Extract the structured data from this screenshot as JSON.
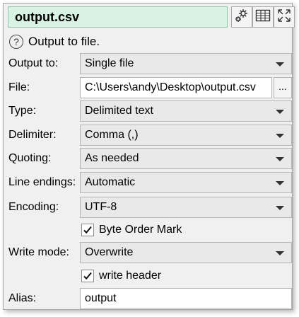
{
  "header": {
    "title": "output.csv"
  },
  "toolbar": {
    "icons": [
      "settings-gear-icon",
      "table-view-icon",
      "expand-arrows-icon"
    ]
  },
  "info": {
    "icon": "help-circle-icon",
    "text": "Output to file."
  },
  "form": {
    "output_to": {
      "label": "Output to:",
      "value": "Single file"
    },
    "file": {
      "label": "File:",
      "value": "C:\\Users\\andy\\Desktop\\output.csv",
      "browse_label": "..."
    },
    "type": {
      "label": "Type:",
      "value": "Delimited text"
    },
    "delimiter": {
      "label": "Delimiter:",
      "value": "Comma (,)"
    },
    "quoting": {
      "label": "Quoting:",
      "value": "As needed"
    },
    "line_endings": {
      "label": "Line endings:",
      "value": "Automatic"
    },
    "encoding": {
      "label": "Encoding:",
      "value": "UTF-8"
    },
    "byte_order_mark": {
      "label": "Byte Order Mark",
      "checked": true
    },
    "write_mode": {
      "label": "Write mode:",
      "value": "Overwrite"
    },
    "write_header": {
      "label": "write header",
      "checked": true
    },
    "alias": {
      "label": "Alias:",
      "value": "output"
    }
  },
  "colors": {
    "title_bg": "#d8f2e4",
    "panel_bg": "#f0f0f0",
    "combo_bg": "#e9e9e9"
  }
}
